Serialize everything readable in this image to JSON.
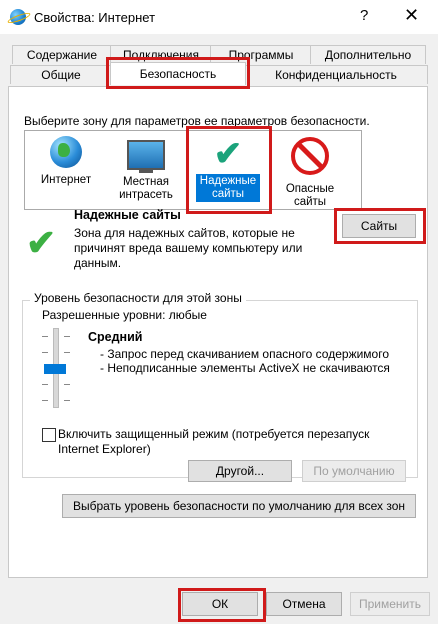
{
  "window": {
    "title": "Свойства: Интернет",
    "help": "?",
    "close": "✕"
  },
  "tabs": {
    "row1": [
      "Содержание",
      "Подключения",
      "Программы",
      "Дополнительно"
    ],
    "row2": [
      "Общие",
      "Безопасность",
      "Конфиденциальность"
    ],
    "active": "Безопасность"
  },
  "zones": {
    "prompt": "Выберите зону для параметров ее параметров безопасности.",
    "items": [
      {
        "label": "Интернет",
        "icon": "globe-icon"
      },
      {
        "label": "Местная интрасеть",
        "icon": "monitor-icon"
      },
      {
        "label": "Надежные сайты",
        "icon": "checkmark-icon",
        "selected": true
      },
      {
        "label": "Опасные сайты",
        "icon": "no-entry-icon"
      }
    ]
  },
  "selected_zone": {
    "title": "Надежные сайты",
    "description": "Зона для надежных сайтов, которые не причинят вреда вашему компьютеру или данным.",
    "sites_button": "Сайты"
  },
  "security_level": {
    "group_title": "Уровень безопасности для этой зоны",
    "allowed": "Разрешенные уровни: любые",
    "level": "Средний",
    "bullets": [
      "- Запрос перед скачиванием опасного содержимого",
      "- Неподписанные элементы ActiveX не скачиваются"
    ],
    "protected_mode_label": "Включить защищенный режим (потребуется перезапуск Internet Explorer)",
    "protected_mode_checked": false,
    "custom_button": "Другой...",
    "default_button": "По умолчанию",
    "reset_all_button": "Выбрать уровень безопасности по умолчанию для всех зон"
  },
  "footer": {
    "ok": "ОК",
    "cancel": "Отмена",
    "apply": "Применить"
  },
  "colors": {
    "highlight": "#d01a1a",
    "selection": "#0078d7",
    "check_green": "#3cb043"
  }
}
